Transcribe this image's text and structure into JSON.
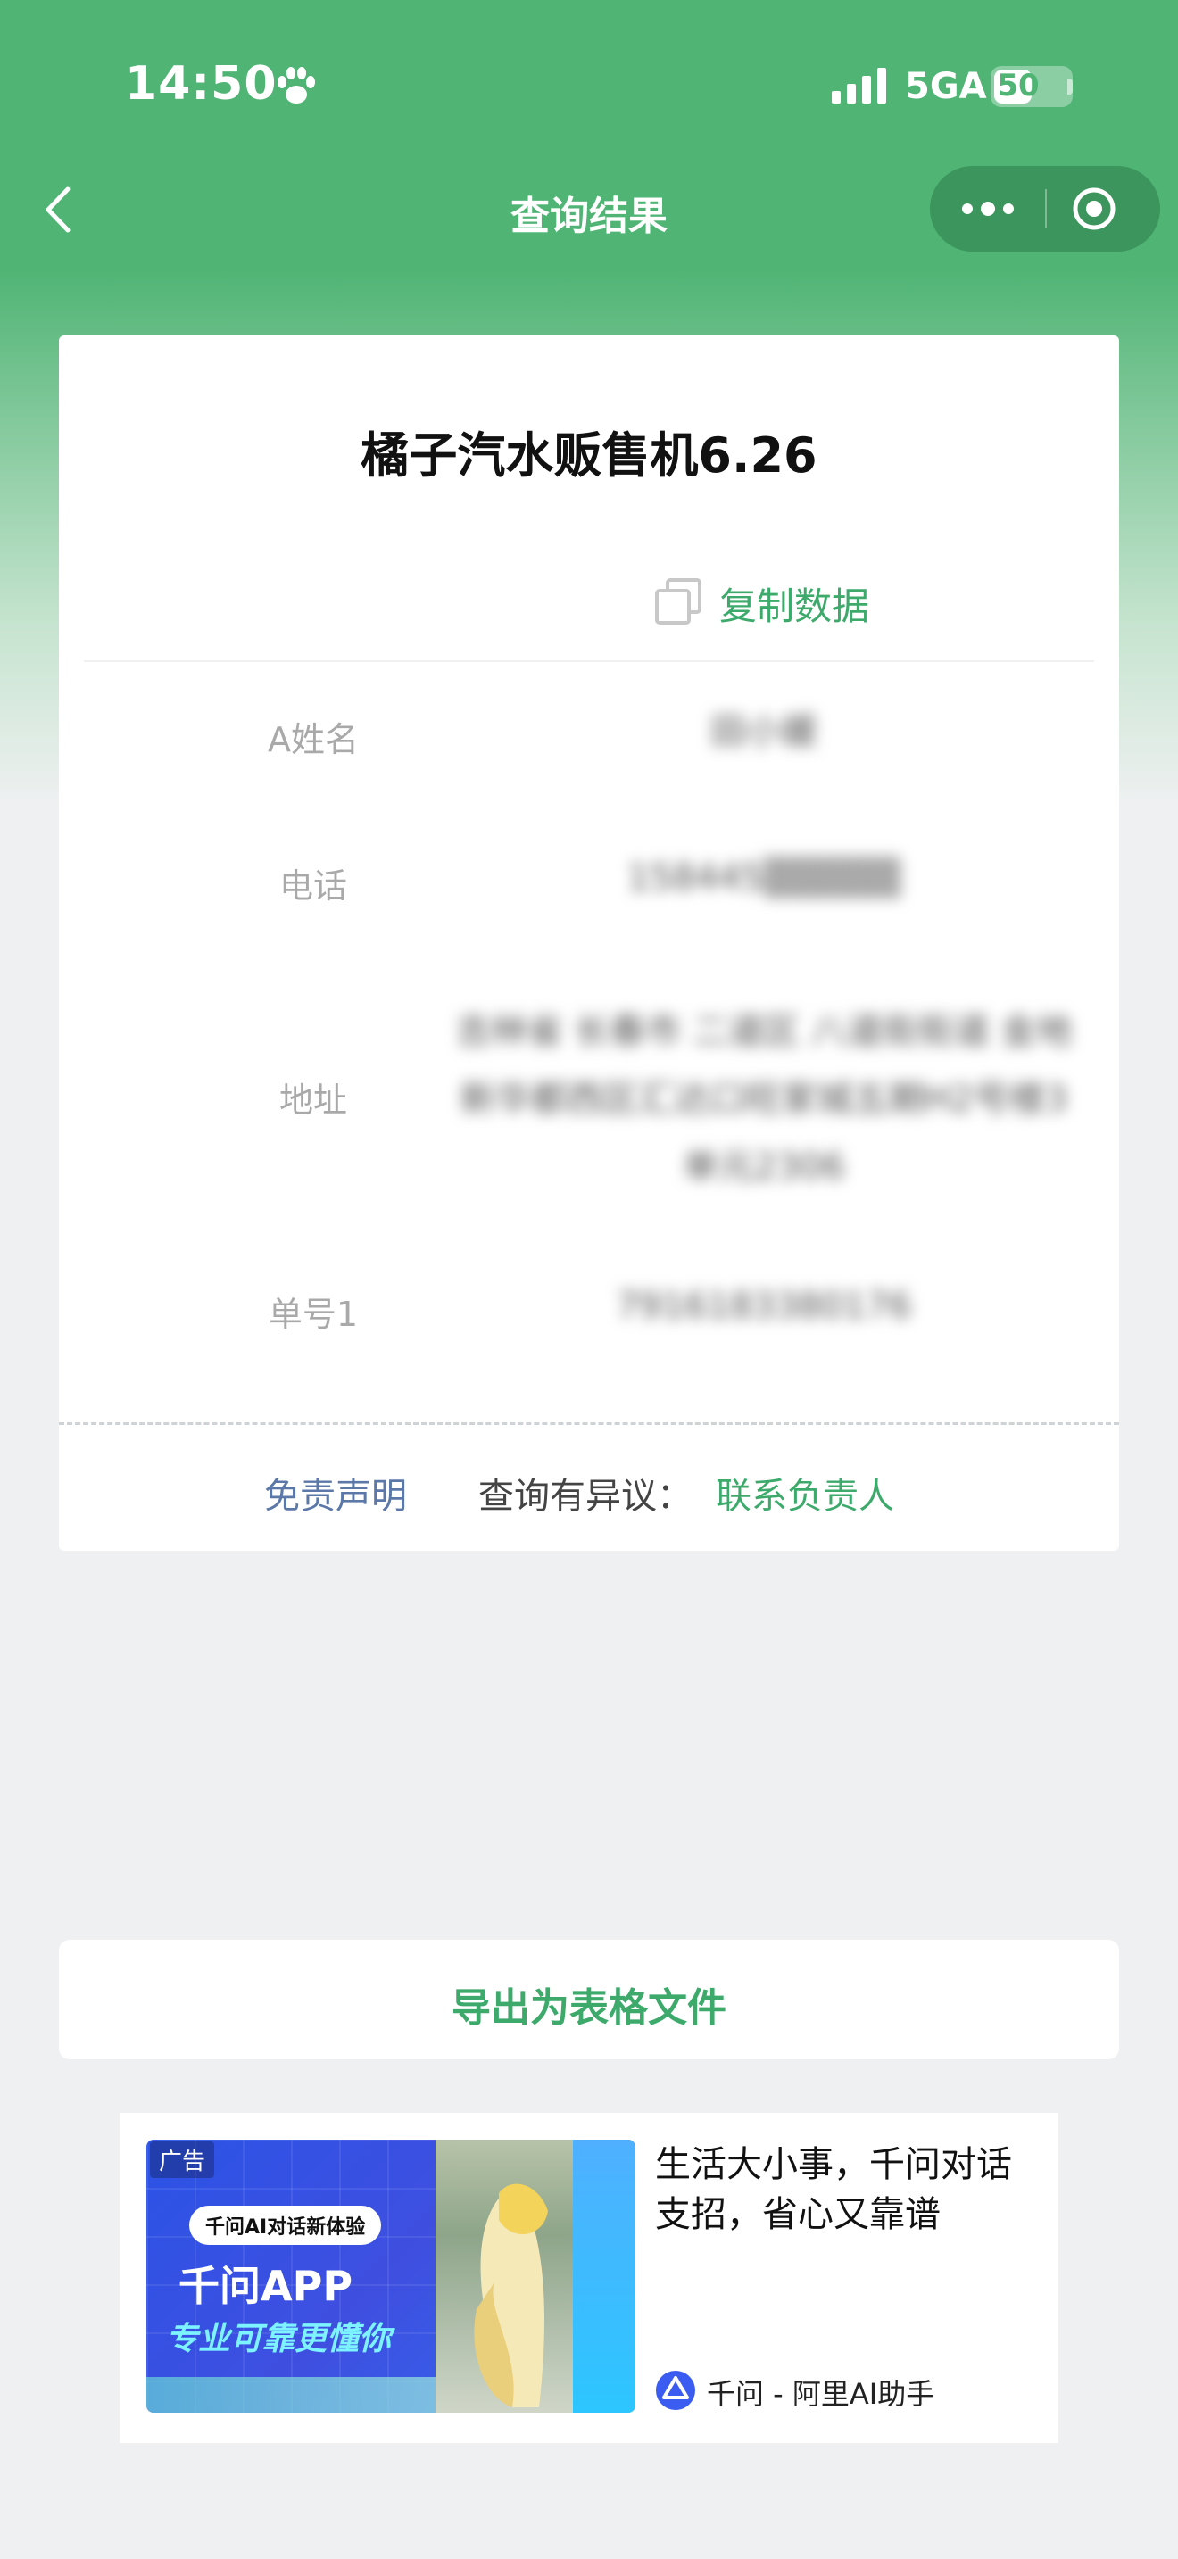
{
  "status": {
    "time": "14:50",
    "network": "5GA",
    "battery": "50",
    "battery_level": 0.5
  },
  "nav": {
    "title": "查询结果"
  },
  "card": {
    "title": "橘子汽水贩售机6.26",
    "copy_label": "复制数据",
    "rows": [
      {
        "label": "A姓名",
        "value": "田小媛"
      },
      {
        "label": "电话",
        "value": "158445▒▒▒▒▒"
      },
      {
        "label": "地址",
        "value": "吉林省 长春市 二道区 八道街街道 金地新华都西区汇达口旺家城五期H2号楼3单元2306"
      },
      {
        "label": "单号1",
        "value": "7916183380176"
      }
    ],
    "disclaimer": "免责声明",
    "objection": "查询有异议：",
    "contact": "联系负责人"
  },
  "export": {
    "label": "导出为表格文件"
  },
  "ad": {
    "tag": "广告",
    "bubble": "千问AI对话新体验",
    "app_name": "千问APP",
    "slogan": "专业可靠更懂你",
    "text": "生活大小事，千问对话支招，省心又靠谱",
    "brand": "千问 - 阿里AI助手"
  }
}
